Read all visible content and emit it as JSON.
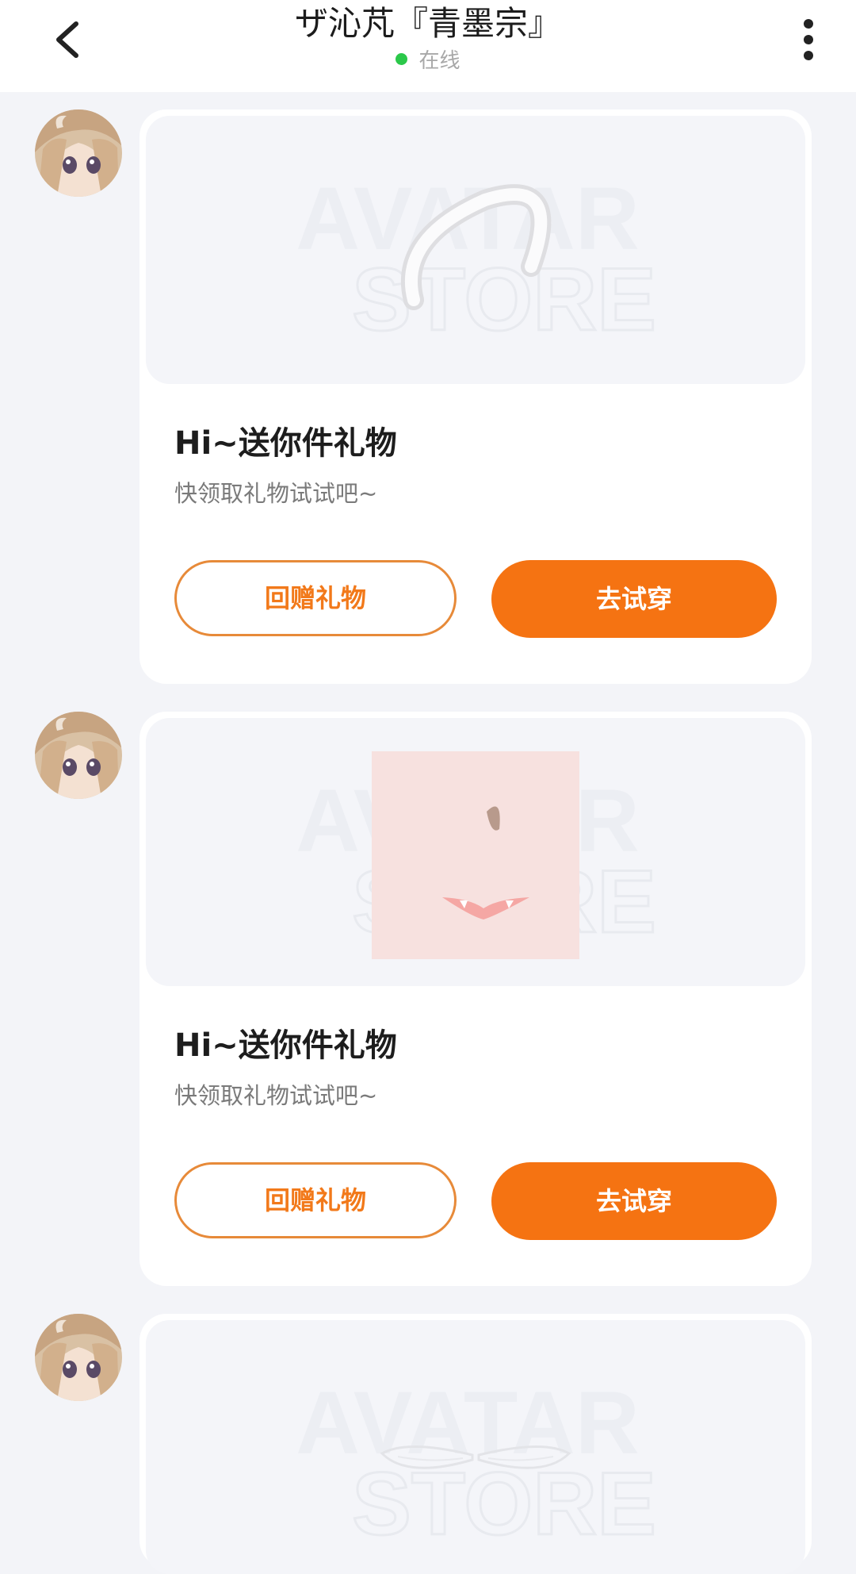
{
  "header": {
    "title": "ザ沁芃『青墨宗』",
    "status": "在线",
    "status_color": "#2bc84a"
  },
  "icons": {
    "back": "back-arrow-icon",
    "more": "more-vertical-icon"
  },
  "watermark": {
    "line1": "AVATAR",
    "line2": "STORE"
  },
  "messages": [
    {
      "item": "headband",
      "title": "Hi~送你件礼物",
      "subtitle": "快领取礼物试试吧~",
      "secondary_button": "回赠礼物",
      "primary_button": "去试穿"
    },
    {
      "item": "face-makeup",
      "title": "Hi~送你件礼物",
      "subtitle": "快领取礼物试试吧~",
      "secondary_button": "回赠礼物",
      "primary_button": "去试穿"
    },
    {
      "item": "wings",
      "title": "",
      "subtitle": "",
      "secondary_button": "",
      "primary_button": ""
    }
  ],
  "colors": {
    "accent": "#f57312",
    "background": "#f3f4f8"
  }
}
